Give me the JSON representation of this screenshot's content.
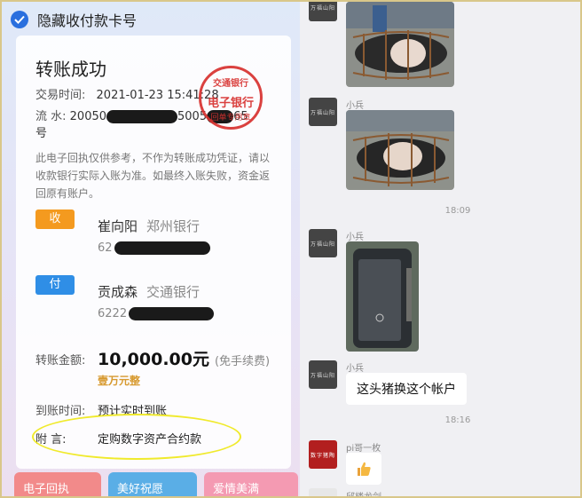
{
  "hide_card": {
    "label": "隐藏收付款卡号"
  },
  "receipt": {
    "title": "转账成功",
    "time_label": "交易时间:",
    "time_value": "2021-01-23 15:41:28",
    "flow_label": "流  水:",
    "flow_prefix": "20050",
    "flow_suffix": "5005",
    "flow_tail": "65",
    "flow_wrap": "号",
    "stamp_top": "交通银行",
    "stamp_mid": "电子银行",
    "stamp_bottom": "回单专用章",
    "notice": "此电子回执仅供参考，不作为转账成功凭证，请以收款银行实际入账为准。如最终入账失败，资金返回原有账户。",
    "payee_badge": "收",
    "payee_name": "崔向阳",
    "payee_bank": "郑州银行",
    "payee_acct": "62",
    "payer_badge": "付",
    "payer_name": "贡成森",
    "payer_bank": "交通银行",
    "payer_acct": "6222",
    "amount_label": "转账金额:",
    "amount": "10,000.00元",
    "fee": "(免手续费)",
    "amount_cn": "壹万元整",
    "arrive_label": "到账时间:",
    "arrive_value": "预计实时到账",
    "memo_label": "附      言:",
    "memo_value": "定购数字资产合约款"
  },
  "bottom_buttons": [
    "电子回执",
    "美好祝愿",
    "爱情美满"
  ],
  "chat": {
    "avatar_text": "万福山阳",
    "sender1": "小兵",
    "time1": "18:09",
    "sender2": "小兵",
    "sender3": "小兵",
    "message1": "这头猪换这个帐户",
    "time2": "18:16",
    "sender4": "pi哥一枚",
    "avatar4_text": "数字猪陶",
    "sender5": "邱楼龙剑"
  }
}
